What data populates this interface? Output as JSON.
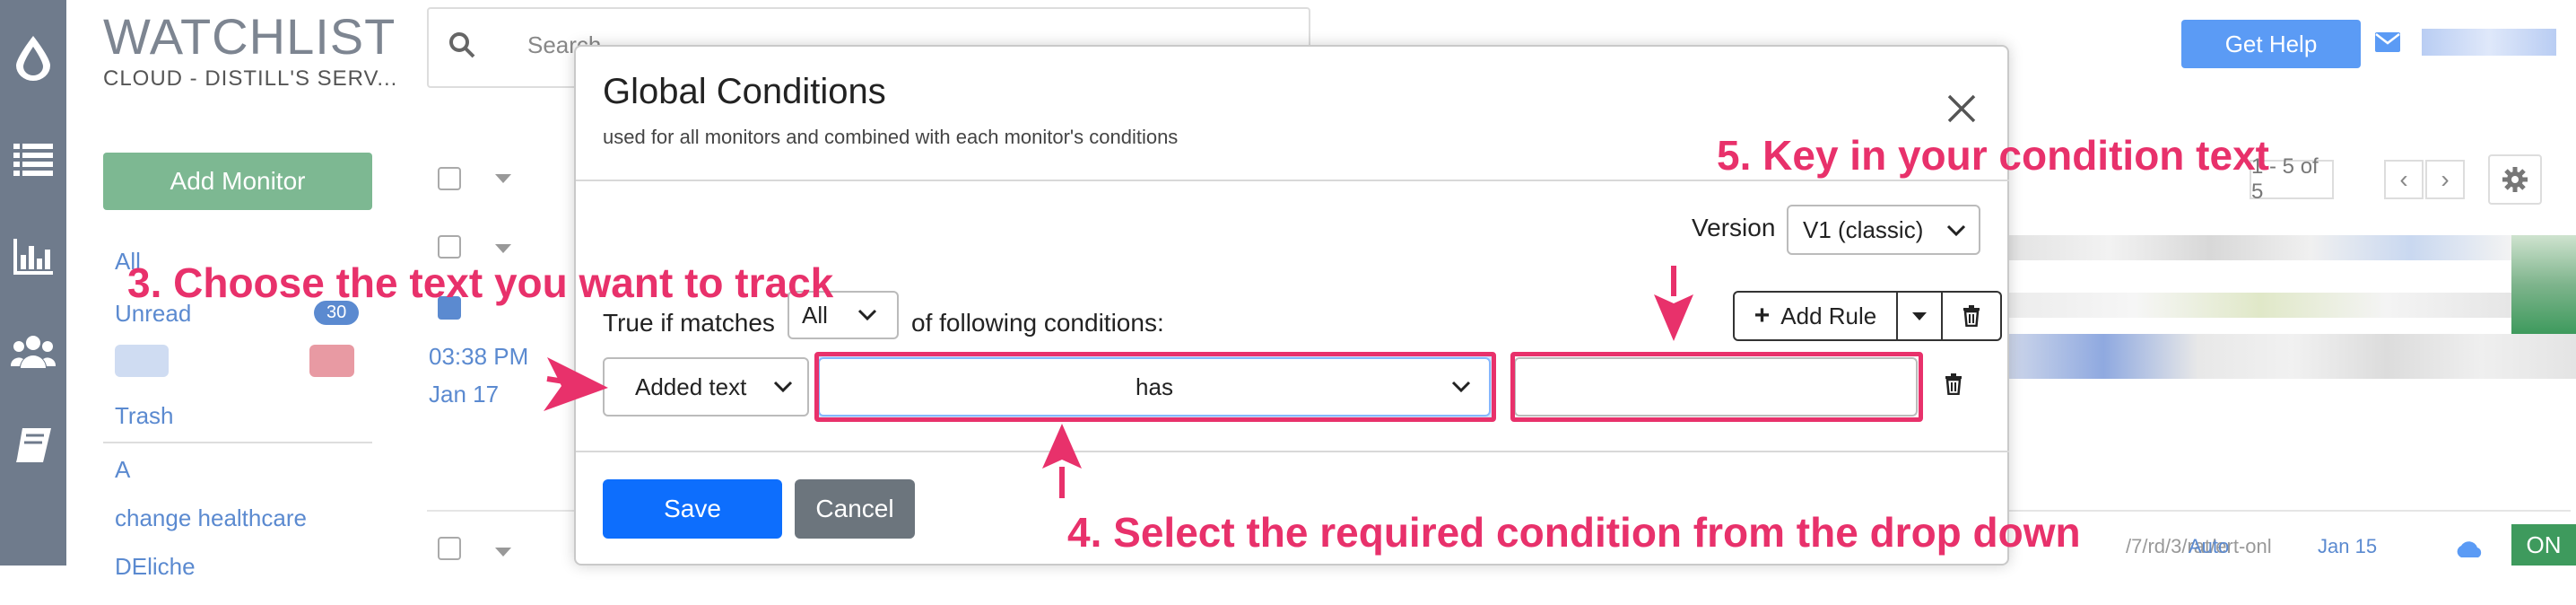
{
  "app": {
    "brand": "WATCHLIST",
    "subbrand": "CLOUD - DISTILL'S SERV...",
    "add_monitor": "Add Monitor",
    "search_placeholder": "Search",
    "get_help": "Get Help",
    "sidebar": {
      "all": "All",
      "unread": "Unread",
      "unread_count": "30",
      "trash": "Trash",
      "section_a": "A",
      "change_healthcare": "change healthcare",
      "deliche": "DEliche"
    },
    "pagination": "1 - 5 of 5",
    "rows": {
      "time": "03:38 PM",
      "date": "Jan 17",
      "last_row_text": "/7/rd/3/rat/ert-onl",
      "last_row_mode": "Auto",
      "last_row_date": "Jan 15",
      "last_row_status": "ON"
    }
  },
  "modal": {
    "title": "Global Conditions",
    "subtitle": "used for all monitors and combined with each monitor's conditions",
    "version_label": "Version",
    "version_value": "V1 (classic)",
    "true_if_label": "True if matches",
    "match_value": "All",
    "following_label": "of following conditions:",
    "add_rule": "Add Rule",
    "rule": {
      "field": "Added text",
      "operator": "has",
      "value": ""
    },
    "save": "Save",
    "cancel": "Cancel"
  },
  "annotations": {
    "step3": "3. Choose the text you want to track",
    "step4": "4. Select the required condition from the drop down",
    "step5": "5. Key in your condition text",
    "color": "#e8316b"
  }
}
